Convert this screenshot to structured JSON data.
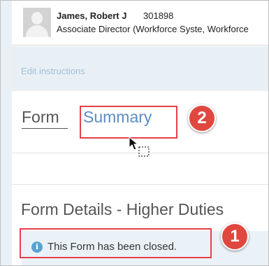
{
  "user": {
    "name": "James, Robert J",
    "id": "301898",
    "title": "Associate Director (Workforce Syste, Workforce"
  },
  "edit_instructions": {
    "label": "Edit instructions"
  },
  "tabs": [
    {
      "label": "Form",
      "active": true
    },
    {
      "label": "Summary",
      "active": false
    }
  ],
  "section": {
    "title": "Form Details - Higher Duties"
  },
  "alert": {
    "icon": "info-icon",
    "icon_glyph": "i",
    "message": "This Form has been closed."
  },
  "annotations": {
    "badge_summary": "2",
    "badge_alert": "1",
    "color": "#e5404a"
  },
  "colors": {
    "link": "#5b8ec2",
    "band": "#e9f0f5",
    "alert_bg": "#eaf2f8",
    "info_icon": "#5aa3d0"
  }
}
